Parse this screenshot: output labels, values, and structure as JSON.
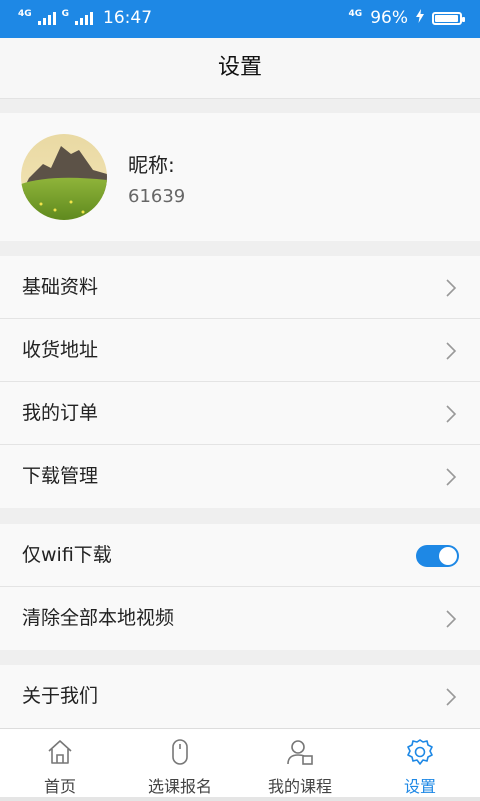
{
  "status_bar": {
    "net1": "4G",
    "net2": "G",
    "time": "16:47",
    "net_right": "4G",
    "battery_pct": "96%",
    "battery_level": 0.96
  },
  "header": {
    "title": "设置"
  },
  "profile": {
    "nickname_label": "昵称:",
    "user_id": "61639"
  },
  "menu_group1": [
    {
      "label": "基础资料"
    },
    {
      "label": "收货地址"
    },
    {
      "label": "我的订单"
    },
    {
      "label": "下载管理"
    }
  ],
  "menu_group2": [
    {
      "label": "仅wifi下载",
      "toggle_on": true
    },
    {
      "label": "清除全部本地视频"
    }
  ],
  "menu_group3": [
    {
      "label": "关于我们"
    }
  ],
  "bottom_nav": [
    {
      "label": "首页",
      "icon": "home-icon"
    },
    {
      "label": "选课报名",
      "icon": "mouse-icon"
    },
    {
      "label": "我的课程",
      "icon": "user-course-icon"
    },
    {
      "label": "设置",
      "icon": "gear-icon",
      "active": true
    }
  ],
  "colors": {
    "accent": "#1e88e5",
    "background": "#efefef",
    "row": "#f9f9f9"
  }
}
